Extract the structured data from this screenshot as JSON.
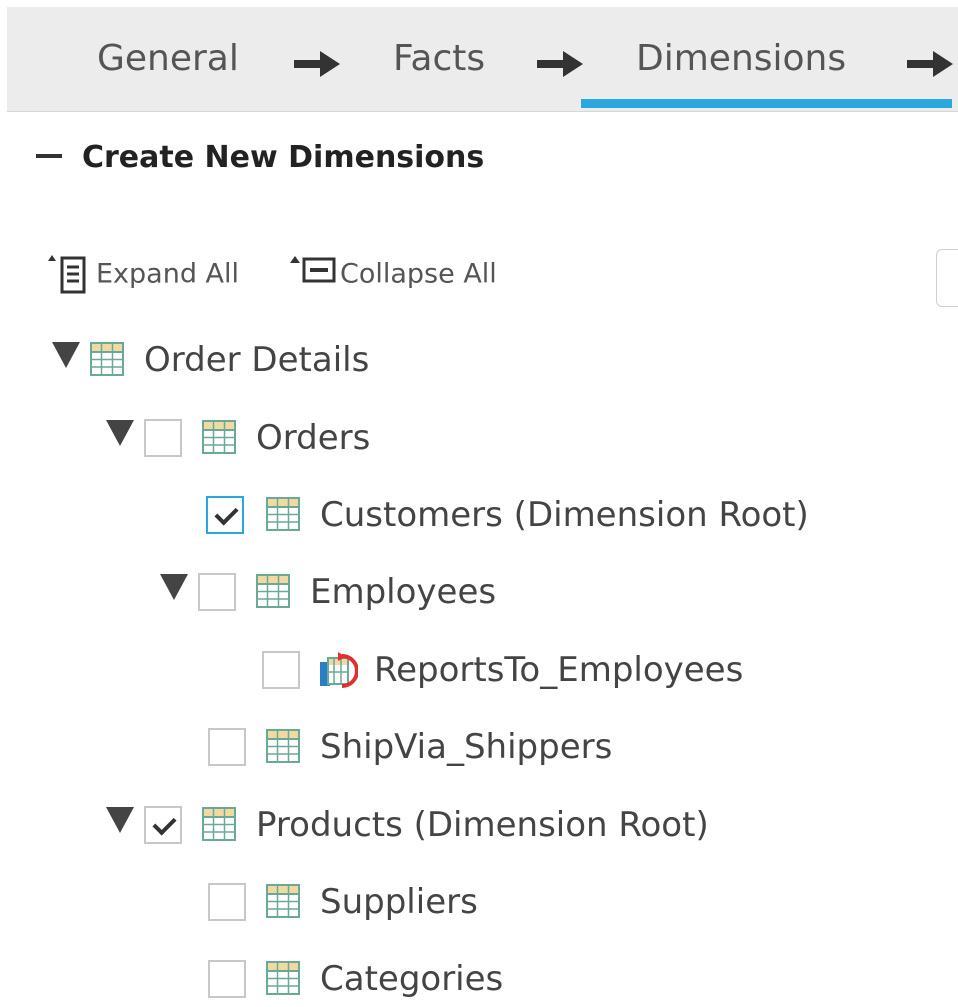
{
  "wizard": {
    "steps": [
      {
        "label": "General"
      },
      {
        "label": "Facts"
      },
      {
        "label": "Dimensions",
        "active": true
      }
    ]
  },
  "section": {
    "title": "Create New Dimensions"
  },
  "toolbar": {
    "expand_all": "Expand All",
    "collapse_all": "Collapse All"
  },
  "tree": {
    "order_details": "Order Details",
    "orders": "Orders",
    "customers": "Customers (Dimension Root)",
    "employees": "Employees",
    "reports_to_employees": "ReportsTo_Employees",
    "ship_via_shippers": "ShipVia_Shippers",
    "products": "Products (Dimension Root)",
    "suppliers": "Suppliers",
    "categories": "Categories"
  },
  "checked": {
    "orders": false,
    "customers": true,
    "employees": false,
    "reports_to_employees": false,
    "ship_via_shippers": false,
    "products": true,
    "suppliers": false,
    "categories": false
  },
  "colors": {
    "accent": "#29a8e0",
    "table_icon": "#5ba38e"
  }
}
